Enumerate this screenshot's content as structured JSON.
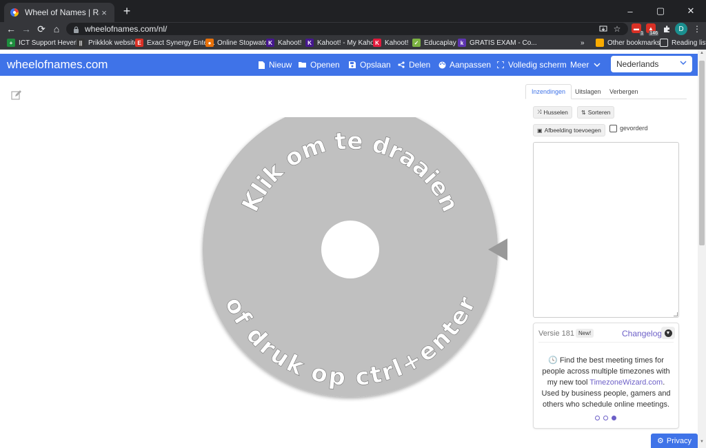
{
  "browser": {
    "tab_title": "Wheel of Names | Random name",
    "tab_close": "×",
    "new_tab": "+",
    "url": "wheelofnames.com/nl/",
    "window_controls": [
      "–",
      "▢",
      "✕"
    ],
    "nav_back": "←",
    "nav_forward": "→",
    "nav_reload": "⟳",
    "nav_home": "⌂",
    "extension_badges": [
      "1",
      "146"
    ],
    "profile_initial": "D",
    "bookmarks": [
      {
        "label": "ICT Support Heverl...",
        "icon_color": "#1e8e3e"
      },
      {
        "label": "Prikklok website",
        "icon_color": "#333333"
      },
      {
        "label": "Exact Synergy Enter...",
        "icon_color": "#d93025"
      },
      {
        "label": "Online Stopwatch",
        "icon_color": "#e8710a"
      },
      {
        "label": "Kahoot!",
        "icon_color": "#46178f"
      },
      {
        "label": "Kahoot! - My Kaho...",
        "icon_color": "#46178f"
      },
      {
        "label": "Kahoot!",
        "icon_color": "#e21b3c"
      },
      {
        "label": "Educaplay",
        "icon_color": "#7cb342"
      },
      {
        "label": "GRATIS EXAM - Co...",
        "icon_color": "#5e35b1"
      }
    ],
    "bookmarks_overflow": "»",
    "other_bookmarks": "Other bookmarks",
    "reading_list": "Reading list"
  },
  "site": {
    "brand": "wheelofnames.com",
    "accent_color": "#3f73e8",
    "nav": [
      {
        "label": "Nieuw",
        "icon": "file-icon"
      },
      {
        "label": "Openen",
        "icon": "folder-open-icon"
      },
      {
        "label": "Opslaan",
        "icon": "save-icon"
      },
      {
        "label": "Delen",
        "icon": "share-icon"
      },
      {
        "label": "Aanpassen",
        "icon": "palette-icon"
      },
      {
        "label": "Volledig scherm",
        "icon": "fullscreen-icon"
      },
      {
        "label": "Meer",
        "icon": "chevron-down-icon"
      }
    ],
    "language": "Nederlands"
  },
  "wheel": {
    "top_text": "Klik om te draaien",
    "bottom_text": "of druk op ctrl+enter",
    "color": "#c0c0c0"
  },
  "panel": {
    "tabs": [
      "Inzendingen",
      "Uitslagen",
      "Verbergen"
    ],
    "shuffle": "Husselen",
    "sort": "Sorteren",
    "add_image": "Afbeelding toevoegen",
    "advanced": "gevorderd",
    "entries_text": ""
  },
  "news_card": {
    "version": "Versie 181",
    "new_badge": "New!",
    "changelog": "Changelog",
    "message_before": "Find the best meeting times for people across multiple timezones with my new tool ",
    "link": "TimezoneWizard.com",
    "message_after": ". Used by business people, gamers and others who schedule online meetings.",
    "dots_active_index": 2
  },
  "privacy": "Privacy"
}
